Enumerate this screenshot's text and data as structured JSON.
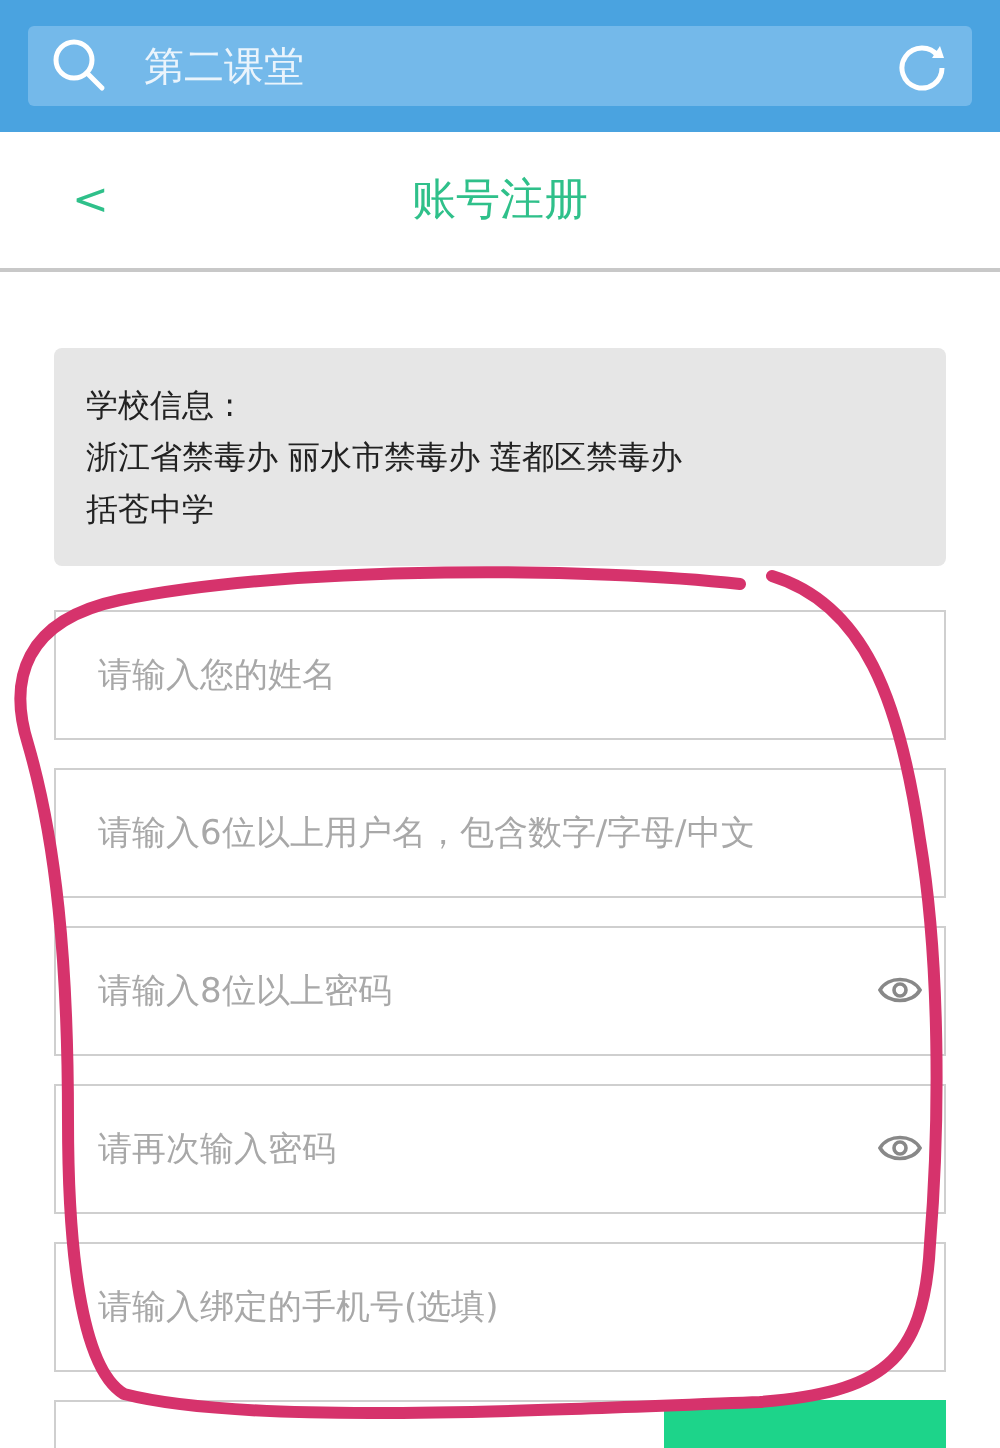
{
  "search_bar": {
    "placeholder": "第二课堂"
  },
  "header": {
    "back": "<",
    "title": "账号注册"
  },
  "school_info": {
    "label": "学校信息 :",
    "lines": [
      "浙江省禁毒办 丽水市禁毒办 莲都区禁毒办",
      "括苍中学"
    ]
  },
  "fields": [
    {
      "placeholder": "请输入您的姓名",
      "reveal_icon": false
    },
    {
      "placeholder": "请输入6位以上用户名，包含数字/字母/中文",
      "reveal_icon": false
    },
    {
      "placeholder": "请输入8位以上密码",
      "reveal_icon": true
    },
    {
      "placeholder": "请再次输入密码",
      "reveal_icon": true
    },
    {
      "placeholder": "请输入绑定的手机号(选填)",
      "reveal_icon": false
    }
  ],
  "annotation": {
    "kind": "freehand_circle",
    "color": "#d6336c"
  }
}
